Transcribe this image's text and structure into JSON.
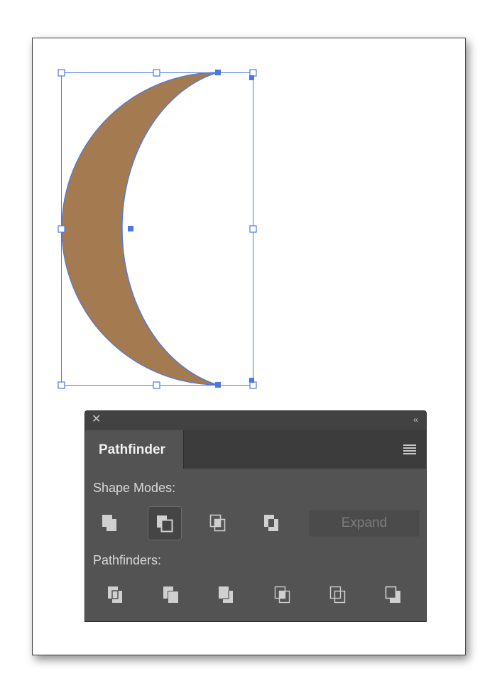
{
  "canvas": {
    "shape": "crescent-moon",
    "fill_color": "#a47a50",
    "selection_color": "#4a78e8"
  },
  "panel": {
    "close_icon": "close-icon",
    "collapse_icon": "double-chevron-left-icon",
    "tab_label": "Pathfinder",
    "menu_icon": "hamburger-menu-icon",
    "shape_modes_label": "Shape Modes:",
    "shape_modes": [
      "unite-icon",
      "minus-front-icon",
      "intersect-icon",
      "exclude-icon"
    ],
    "expand_label": "Expand",
    "pathfinders_label": "Pathfinders:",
    "pathfinders": [
      "divide-icon",
      "trim-icon",
      "merge-icon",
      "crop-icon",
      "outline-icon",
      "minus-back-icon"
    ],
    "background": "#535353",
    "icon_color": "#d0d0d0"
  }
}
